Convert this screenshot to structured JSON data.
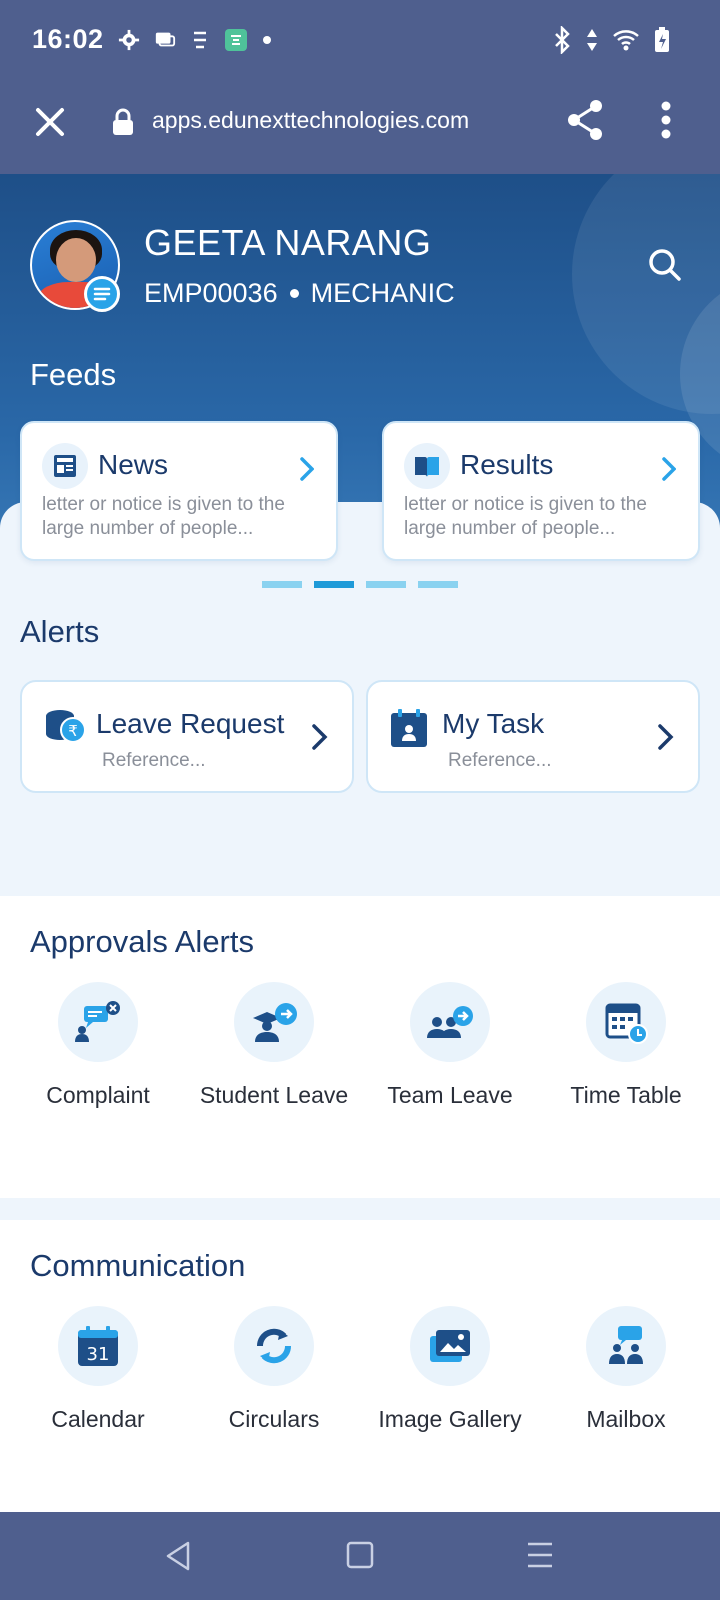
{
  "status_bar": {
    "time": "16:02"
  },
  "browser": {
    "url": "apps.edunexttechnologies.com"
  },
  "profile": {
    "name": "GEETA NARANG",
    "emp_id": "EMP00036",
    "role": "MECHANIC"
  },
  "feeds": {
    "title": "Feeds",
    "cards": [
      {
        "title": "News",
        "description": "letter or notice is given to the large number of people...",
        "icon": "news-icon"
      },
      {
        "title": "Results",
        "description": "letter or notice is given to the large number of people...",
        "icon": "results-book-icon"
      }
    ],
    "pager": {
      "count": 4,
      "active": 2
    }
  },
  "alerts": {
    "title": "Alerts",
    "cards": [
      {
        "title": "Leave Request",
        "subtitle": "Reference...",
        "icon": "leave-coins-icon"
      },
      {
        "title": "My Task",
        "subtitle": "Reference...",
        "icon": "task-calendar-icon"
      }
    ]
  },
  "approvals": {
    "title": "Approvals Alerts",
    "items": [
      {
        "label": "Complaint",
        "icon": "complaint-icon"
      },
      {
        "label": "Student Leave",
        "icon": "student-leave-icon"
      },
      {
        "label": "Team Leave",
        "icon": "team-leave-icon"
      },
      {
        "label": "Time Table",
        "icon": "timetable-icon"
      }
    ]
  },
  "communication": {
    "title": "Communication",
    "items": [
      {
        "label": "Calendar",
        "icon": "calendar-icon",
        "calendar_day": "31"
      },
      {
        "label": "Circulars",
        "icon": "circulars-icon"
      },
      {
        "label": "Image Gallery",
        "icon": "image-gallery-icon"
      },
      {
        "label": "Mailbox",
        "icon": "mailbox-icon"
      }
    ]
  },
  "colors": {
    "primary": "#1b3a6b",
    "accent": "#2aa3e8",
    "bar": "#4f5f8e"
  }
}
